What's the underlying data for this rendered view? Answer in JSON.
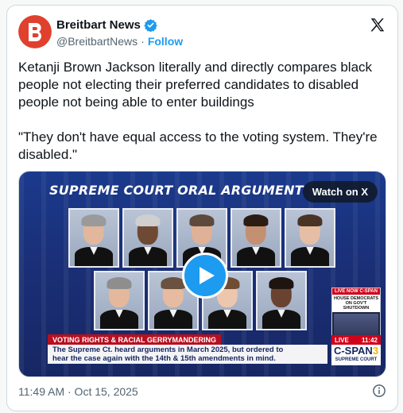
{
  "author": {
    "name": "Breitbart News",
    "handle": "@BreitbartNews",
    "separator": "·",
    "follow_label": "Follow",
    "brand_color": "#e0402e"
  },
  "tweet": {
    "text_p1": "Ketanji Brown Jackson literally and directly compares black people not electing their preferred candidates to disabled people not being able to enter buildings",
    "text_p2": "\"They don't have equal access to the voting system. They're disabled.\"",
    "timestamp": "11:49 AM · Oct 15, 2025"
  },
  "media": {
    "banner_title": "SUPREME COURT ORAL ARGUMENT",
    "watch_label": "Watch on X",
    "lower_third_label": "VOTING RIGHTS & RACIAL GERRYMANDERING",
    "lower_third_line1": "The Supreme Ct. heard arguments in March 2025, but ordered to",
    "lower_third_line2": "hear the case again with the 14th & 15th amendments in mind.",
    "live_now": "LIVE NOW C-SPAN",
    "live_headline": "HOUSE DEMOCRATS ON GOV'T SHUTDOWN",
    "live_label": "LIVE",
    "live_time": "11:42",
    "network_name": "C-SPAN",
    "network_number": "3",
    "network_sub": "SUPREME COURT"
  },
  "icons": {
    "logo": "x-logo-icon",
    "verified": "verified-badge-icon",
    "play": "play-icon",
    "info": "info-icon"
  },
  "colors": {
    "accent": "#1d9bf0",
    "secondary_text": "#536471",
    "banner_blue": "#1b3a8c",
    "cspan_red": "#d0021b"
  }
}
